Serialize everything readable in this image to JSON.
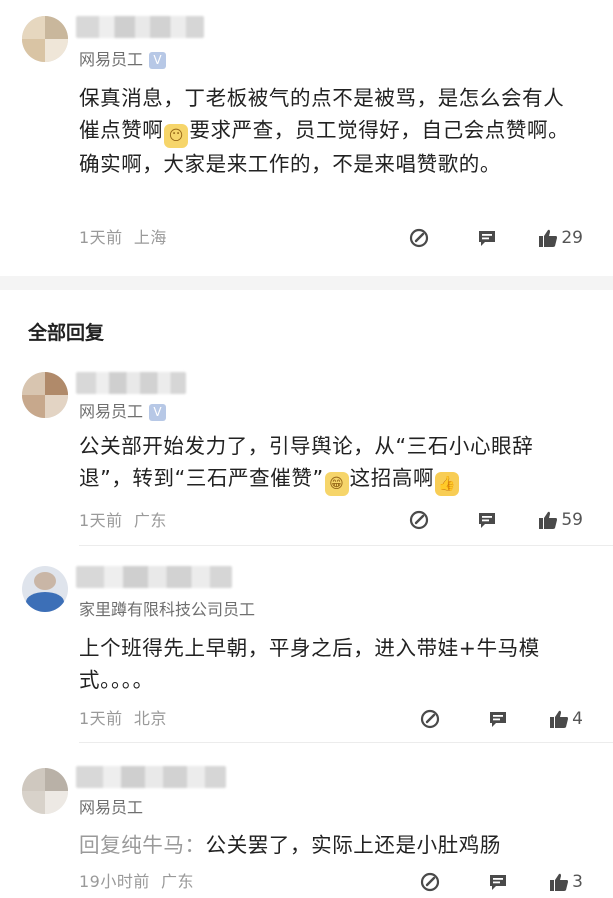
{
  "top_comment": {
    "badge": "网易员工",
    "text_before_emoji": "保真消息，丁老板被气的点不是被骂，是怎么会有人催点赞啊",
    "emoji_label": "大无语",
    "text_after_emoji": "要求严查，员工觉得好，自己会点赞啊。确实啊，大家是来工作的，不是来唱赞歌的。",
    "time": "1天前",
    "location": "上海",
    "likes": "29"
  },
  "section": {
    "title": "全部回复"
  },
  "replies": [
    {
      "badge": "网易员工",
      "text_before_emoji": "公关部开始发力了，引导舆论，从“三石小心眼辞退”，转到“三石严查催赞”",
      "text_after_emoji": "这招高啊",
      "time": "1天前",
      "location": "广东",
      "likes": "59"
    },
    {
      "badge": "家里蹲有限科技公司员工",
      "text": "上个班得先上早朝，平身之后，进入带娃+牛马模式。。。。",
      "time": "1天前",
      "location": "北京",
      "likes": "4"
    },
    {
      "badge": "网易员工",
      "reply_prefix": "回复纯牛马：",
      "text": "公关罢了，实际上还是小肚鸡肠",
      "time": "19小时前",
      "location": "广东",
      "likes": "3"
    }
  ],
  "icons": {
    "edit": "edit-reply-icon",
    "comment": "comment-icon",
    "like": "thumbs-up-icon"
  },
  "colors": {
    "icon": "#4a4a4a",
    "meta": "#9a9a9a",
    "verified": "#b7c8e6"
  }
}
